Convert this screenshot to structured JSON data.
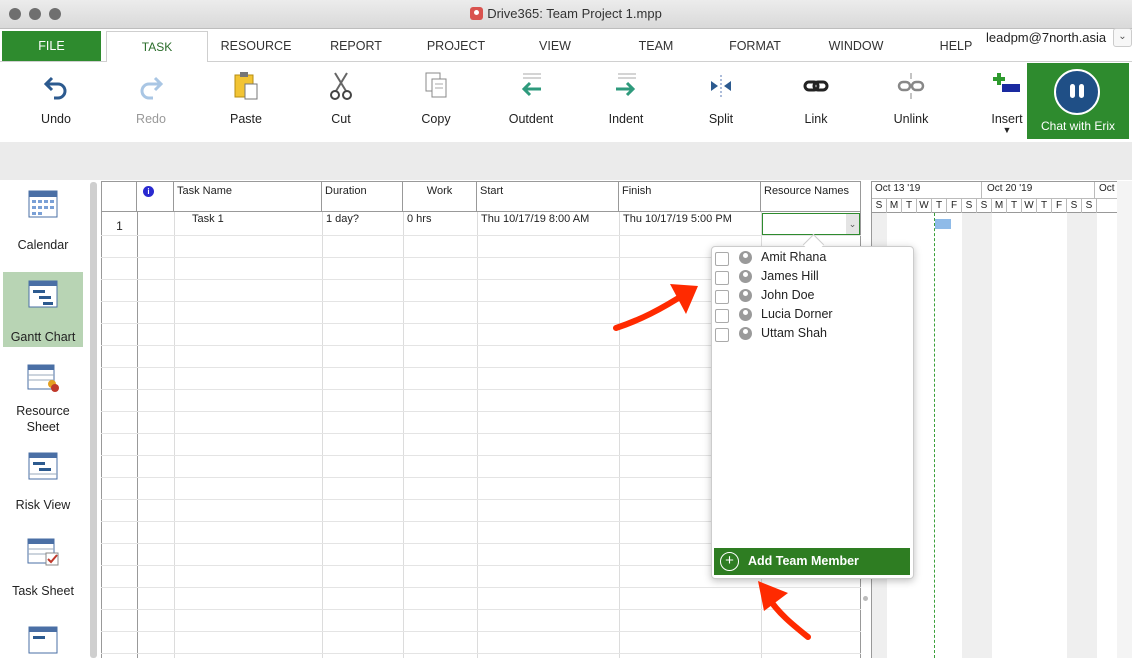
{
  "window": {
    "title": "Drive365: Team Project 1.mpp"
  },
  "tabs": {
    "file": "FILE",
    "items": [
      "TASK",
      "RESOURCE",
      "REPORT",
      "PROJECT",
      "VIEW",
      "TEAM",
      "FORMAT",
      "WINDOW",
      "HELP"
    ]
  },
  "user": {
    "email": "leadpm@7north.asia"
  },
  "ribbon": {
    "undo": "Undo",
    "redo": "Redo",
    "paste": "Paste",
    "cut": "Cut",
    "copy": "Copy",
    "outdent": "Outdent",
    "indent": "Indent",
    "split": "Split",
    "link": "Link",
    "unlink": "Unlink",
    "insert": "Insert",
    "chat": "Chat with Erix"
  },
  "sidebar": {
    "calendar": "Calendar",
    "gantt": "Gantt Chart",
    "resource_line1": "Resource",
    "resource_line2": "Sheet",
    "risk": "Risk View",
    "task_sheet": "Task Sheet"
  },
  "grid": {
    "headers": {
      "info": "i",
      "task_name": "Task Name",
      "duration": "Duration",
      "work": "Work",
      "start": "Start",
      "finish": "Finish",
      "resources": "Resource Names"
    },
    "rows": [
      {
        "id": "1",
        "name": "Task 1",
        "duration": "1 day?",
        "work": "0 hrs",
        "start": "Thu 10/17/19 8:00 AM",
        "finish": "Thu 10/17/19 5:00 PM"
      }
    ]
  },
  "gantt": {
    "weeks": [
      "Oct 13 '19",
      "Oct 20 '19",
      "Oct"
    ],
    "days": [
      "S",
      "M",
      "T",
      "W",
      "T",
      "F",
      "S",
      "S",
      "M",
      "T",
      "W",
      "T",
      "F",
      "S",
      "S"
    ]
  },
  "resource_popup": {
    "members": [
      "Amit Rhana",
      "James Hill",
      "John Doe",
      "Lucia Dorner",
      "Uttam Shah"
    ],
    "add_button": "Add Team Member"
  },
  "colors": {
    "accent": "#2e8b2e",
    "chat_bubble": "#1f4f86",
    "annotation_arrow": "#ff2a00"
  }
}
